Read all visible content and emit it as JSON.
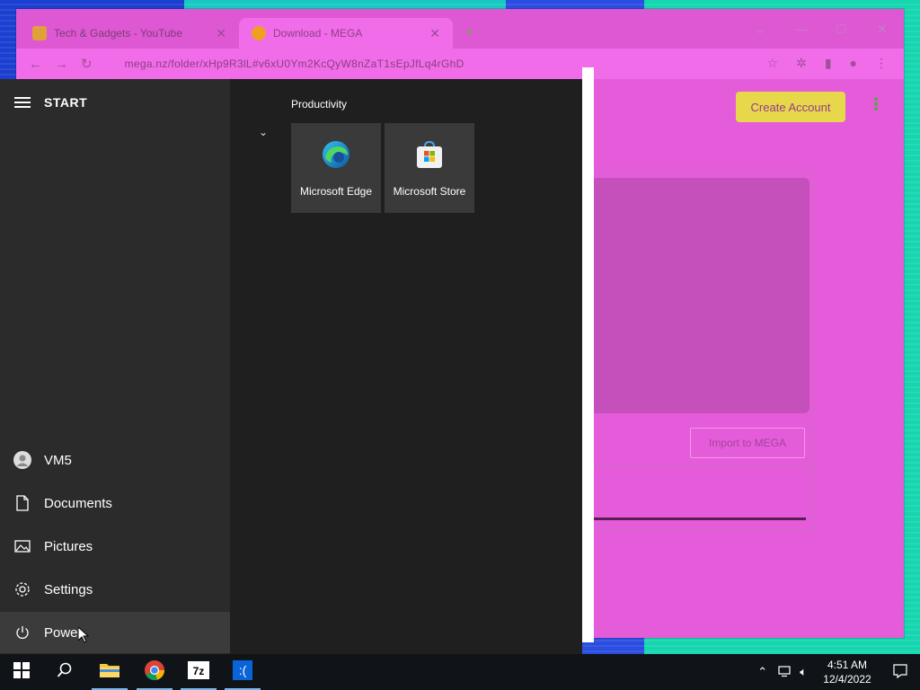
{
  "browser": {
    "tabs": [
      {
        "title": "Tech & Gadgets - YouTube",
        "active": false
      },
      {
        "title": "Download - MEGA",
        "active": true
      }
    ],
    "new_tab_symbol": "+",
    "url": "mega.nz/folder/xHp9R3lL#v6xU0Ym2KcQyW8nZaT1sEpJfLq4rGhD",
    "page": {
      "create_account_label": "Create Account",
      "import_label": "Import to MEGA"
    }
  },
  "start_menu": {
    "title": "START",
    "side_items": [
      {
        "label": "VM5",
        "icon": "user-avatar-icon"
      },
      {
        "label": "Documents",
        "icon": "document-icon"
      },
      {
        "label": "Pictures",
        "icon": "pictures-icon"
      },
      {
        "label": "Settings",
        "icon": "gear-icon"
      },
      {
        "label": "Power",
        "icon": "power-icon"
      }
    ],
    "group_title": "Productivity",
    "tiles": [
      {
        "label": "Microsoft Edge",
        "icon": "edge-icon"
      },
      {
        "label": "Microsoft Store",
        "icon": "store-icon"
      }
    ]
  },
  "taskbar": {
    "time": "4:51 AM",
    "date": "12/4/2022",
    "pinned": [
      "start-button",
      "search-button",
      "file-explorer",
      "chrome",
      "7zip",
      "active-app"
    ]
  },
  "colors": {
    "start_bg": "#1f1f1f",
    "start_left_bg": "#2b2b2b",
    "taskbar_bg": "#101418",
    "browser_tint": "#e45cd9",
    "create_btn": "#e6d84a"
  }
}
